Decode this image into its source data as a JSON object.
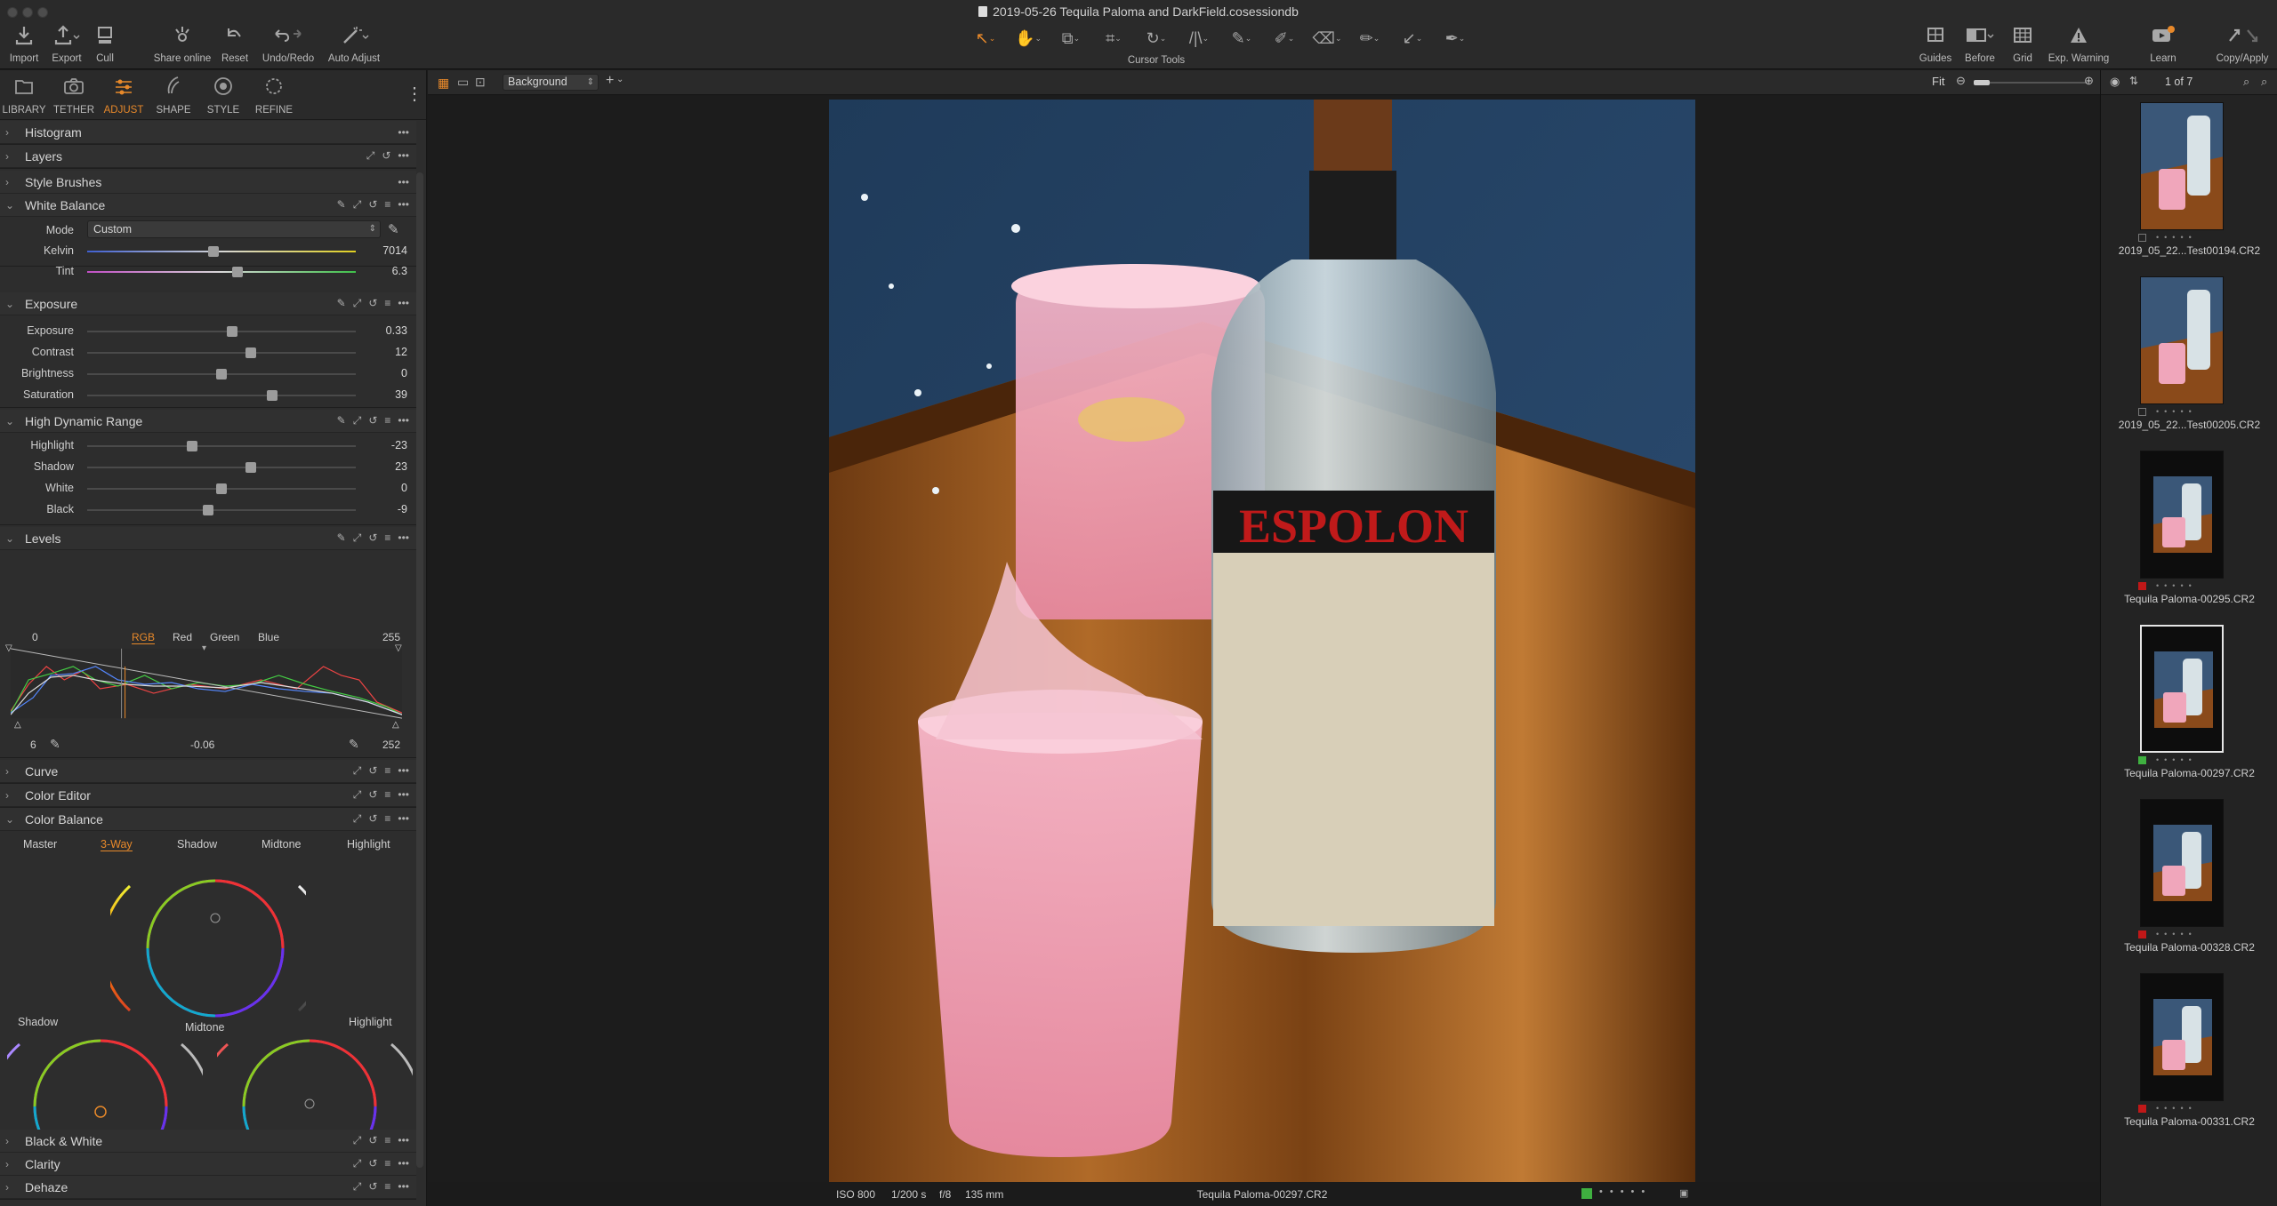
{
  "window": {
    "title": "2019-05-26 Tequila Paloma and DarkField.cosessiondb"
  },
  "toolbar": {
    "left": [
      {
        "label": "Import",
        "icon": "download-icon"
      },
      {
        "label": "Export",
        "icon": "upload-icon"
      },
      {
        "label": "Cull",
        "icon": "cull-icon"
      },
      {
        "label": "Share online",
        "icon": "share-icon"
      },
      {
        "label": "Reset",
        "icon": "reset-icon"
      },
      {
        "label": "Undo/Redo",
        "icon": "undo-icon"
      },
      {
        "label": "Auto Adjust",
        "icon": "wand-icon"
      }
    ],
    "cursor_tools_label": "Cursor Tools",
    "right": [
      {
        "label": "Guides",
        "icon": "guides-icon"
      },
      {
        "label": "Before",
        "icon": "before-icon"
      },
      {
        "label": "Grid",
        "icon": "grid-icon"
      },
      {
        "label": "Exp. Warning",
        "icon": "warning-icon"
      },
      {
        "label": "Learn",
        "icon": "learn-icon"
      },
      {
        "label": "Copy/Apply",
        "icon": "copy-apply-icon"
      }
    ]
  },
  "tool_tabs": [
    {
      "label": "LIBRARY",
      "icon": "folder-icon"
    },
    {
      "label": "TETHER",
      "icon": "camera-icon"
    },
    {
      "label": "ADJUST",
      "icon": "sliders-icon",
      "active": true
    },
    {
      "label": "SHAPE",
      "icon": "shape-icon"
    },
    {
      "label": "STYLE",
      "icon": "style-icon"
    },
    {
      "label": "REFINE",
      "icon": "refine-icon"
    }
  ],
  "sections": {
    "histogram": "Histogram",
    "layers": "Layers",
    "style_brushes": "Style Brushes",
    "white_balance": "White Balance",
    "exposure": "Exposure",
    "hdr": "High Dynamic Range",
    "levels": "Levels",
    "curve": "Curve",
    "color_editor": "Color Editor",
    "color_balance": "Color Balance",
    "black_white": "Black & White",
    "clarity": "Clarity",
    "dehaze": "Dehaze"
  },
  "white_balance": {
    "mode_label": "Mode",
    "mode_value": "Custom",
    "sliders": [
      {
        "label": "Kelvin",
        "value": "7014",
        "pos": 0.47
      },
      {
        "label": "Tint",
        "value": "6.3",
        "pos": 0.56
      }
    ]
  },
  "exposure": {
    "sliders": [
      {
        "label": "Exposure",
        "value": "0.33",
        "pos": 0.54
      },
      {
        "label": "Contrast",
        "value": "12",
        "pos": 0.61
      },
      {
        "label": "Brightness",
        "value": "0",
        "pos": 0.5
      },
      {
        "label": "Saturation",
        "value": "39",
        "pos": 0.69
      }
    ]
  },
  "hdr": {
    "sliders": [
      {
        "label": "Highlight",
        "value": "-23",
        "pos": 0.39
      },
      {
        "label": "Shadow",
        "value": "23",
        "pos": 0.61
      },
      {
        "label": "White",
        "value": "0",
        "pos": 0.5
      },
      {
        "label": "Black",
        "value": "-9",
        "pos": 0.45
      }
    ]
  },
  "levels": {
    "input_low": "0",
    "input_high": "255",
    "channels": [
      "RGB",
      "Red",
      "Green",
      "Blue"
    ],
    "active_channel": "RGB",
    "output_low": "6",
    "midtone": "-0.06",
    "output_high": "252"
  },
  "color_balance": {
    "tabs": [
      "Master",
      "3-Way",
      "Shadow",
      "Midtone",
      "Highlight"
    ],
    "active_tab": "3-Way",
    "wheel_labels": {
      "shadow": "Shadow",
      "midtone": "Midtone",
      "highlight": "Highlight"
    }
  },
  "viewer": {
    "variant_label": "Background",
    "zoom_label": "Fit",
    "status": {
      "iso": "ISO 800",
      "shutter": "1/200 s",
      "aperture": "f/8",
      "focal": "135 mm",
      "filename": "Tequila Paloma-00297.CR2"
    }
  },
  "browser": {
    "count": "1 of 7",
    "thumbs": [
      {
        "name": "2019_05_22...Test00194.CR2",
        "tag": "",
        "variant": "light"
      },
      {
        "name": "2019_05_22...Test00205.CR2",
        "tag": "",
        "variant": "light"
      },
      {
        "name": "Tequila Paloma-00295.CR2",
        "tag": "#c01818",
        "variant": "dark"
      },
      {
        "name": "Tequila Paloma-00297.CR2",
        "tag": "#3fb040",
        "variant": "dark",
        "selected": true
      },
      {
        "name": "Tequila Paloma-00328.CR2",
        "tag": "#c01818",
        "variant": "dark"
      },
      {
        "name": "Tequila Paloma-00331.CR2",
        "tag": "#c01818",
        "variant": "dark"
      }
    ]
  },
  "colors": {
    "accent": "#e8892a",
    "panel": "#2d2d2d",
    "background": "#1b1b1b"
  }
}
